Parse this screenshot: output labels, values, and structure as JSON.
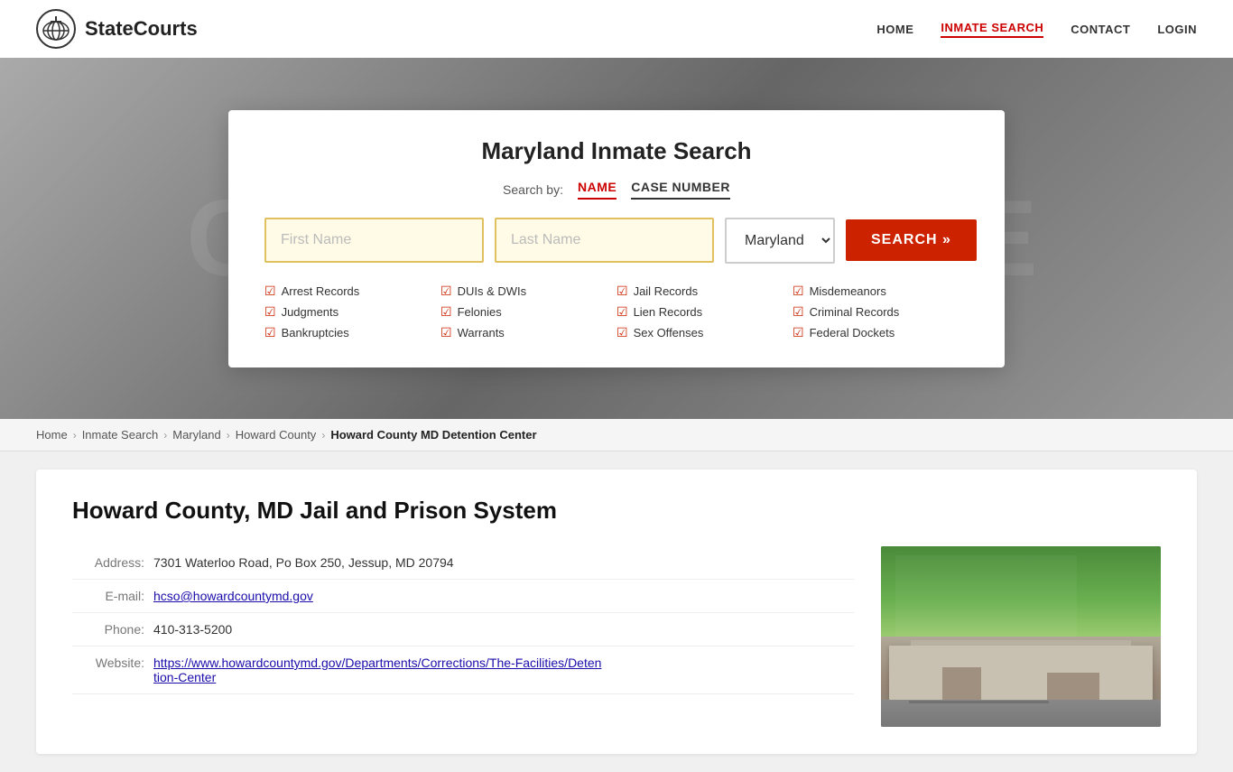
{
  "site": {
    "name": "StateCourts"
  },
  "nav": {
    "home_label": "HOME",
    "inmate_search_label": "INMATE SEARCH",
    "contact_label": "CONTACT",
    "login_label": "LOGIN"
  },
  "hero": {
    "bg_text": "COURTHOUSE"
  },
  "search": {
    "title": "Maryland Inmate Search",
    "search_by_label": "Search by:",
    "tab_name": "NAME",
    "tab_case": "CASE NUMBER",
    "first_name_placeholder": "First Name",
    "last_name_placeholder": "Last Name",
    "state_default": "Maryland",
    "button_label": "SEARCH »",
    "checklist": [
      "Arrest Records",
      "DUIs & DWIs",
      "Jail Records",
      "Misdemeanors",
      "Judgments",
      "Felonies",
      "Lien Records",
      "Criminal Records",
      "Bankruptcies",
      "Warrants",
      "Sex Offenses",
      "Federal Dockets"
    ]
  },
  "breadcrumb": {
    "items": [
      {
        "label": "Home",
        "active": false
      },
      {
        "label": "Inmate Search",
        "active": false
      },
      {
        "label": "Maryland",
        "active": false
      },
      {
        "label": "Howard County",
        "active": false
      },
      {
        "label": "Howard County MD Detention Center",
        "active": true
      }
    ]
  },
  "facility": {
    "title": "Howard County, MD Jail and Prison System",
    "address_label": "Address:",
    "address_value": "7301 Waterloo Road, Po Box 250, Jessup, MD 20794",
    "email_label": "E-mail:",
    "email_value": "hcso@howardcountymd.gov",
    "phone_label": "Phone:",
    "phone_value": "410-313-5200",
    "website_label": "Website:",
    "website_value": "https://www.howardcountymd.gov/Departments/Corrections/The-Facilities/Detention-Center"
  },
  "colors": {
    "accent_red": "#cc2200",
    "nav_active": "#cc0000",
    "input_border": "#e0c060",
    "input_bg": "#fffbe6",
    "link_color": "#1a0dab"
  }
}
